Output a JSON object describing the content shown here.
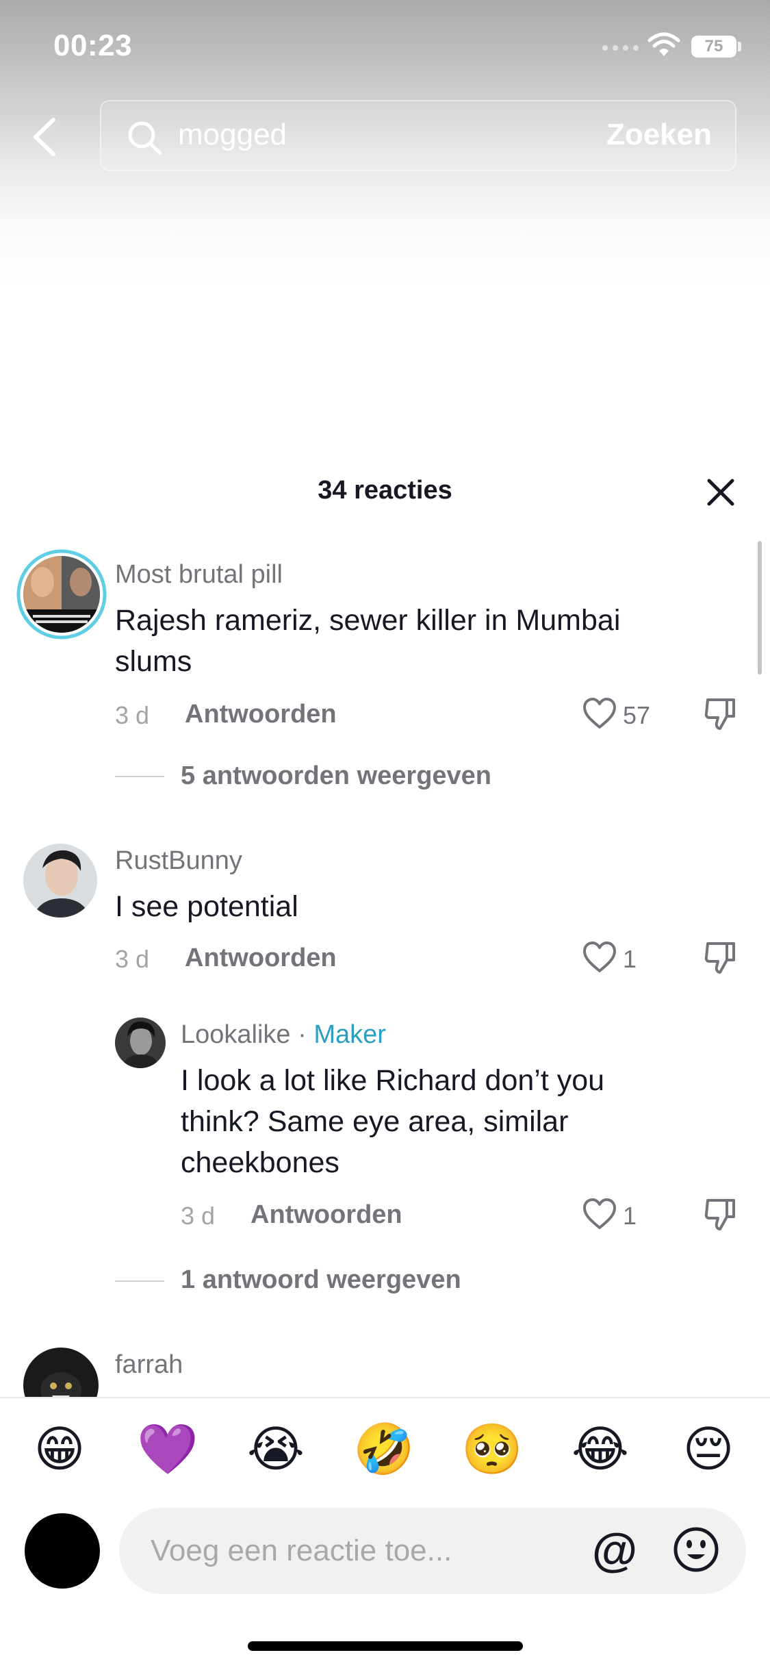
{
  "status_bar": {
    "time": "00:23",
    "battery": "75"
  },
  "search": {
    "query": "mogged",
    "button_label": "Zoeken"
  },
  "sheet": {
    "title": "34 reacties"
  },
  "comments": [
    {
      "username": "Most brutal pill",
      "text_lines": [
        "Rajesh rameriz, sewer killer in Mumbai",
        "slums"
      ],
      "time": "3 d",
      "reply_label": "Antwoorden",
      "likes": "57",
      "view_replies": "5 antwoorden weergeven"
    },
    {
      "username": "RustBunny",
      "text_lines": [
        "I see potential"
      ],
      "time": "3 d",
      "reply_label": "Antwoorden",
      "likes": "1"
    },
    {
      "username": "Lookalike",
      "badge": "Maker",
      "text_lines": [
        "I look a lot like Richard don’t you",
        "think? Same eye area, similar",
        "cheekbones"
      ],
      "time": "3 d",
      "reply_label": "Antwoorden",
      "likes": "1",
      "view_replies": "1 antwoord weergeven"
    },
    {
      "username": "farrah"
    }
  ],
  "emoji_bar": [
    "😁",
    "💜",
    "😭",
    "🤣",
    "🥺",
    "😂",
    "😔"
  ],
  "composer": {
    "placeholder": "Voeg een reactie toe...",
    "at_symbol": "@"
  },
  "colors": {
    "creator_badge": "#2a9fc2",
    "avatar_ring": "#5fcde4"
  }
}
